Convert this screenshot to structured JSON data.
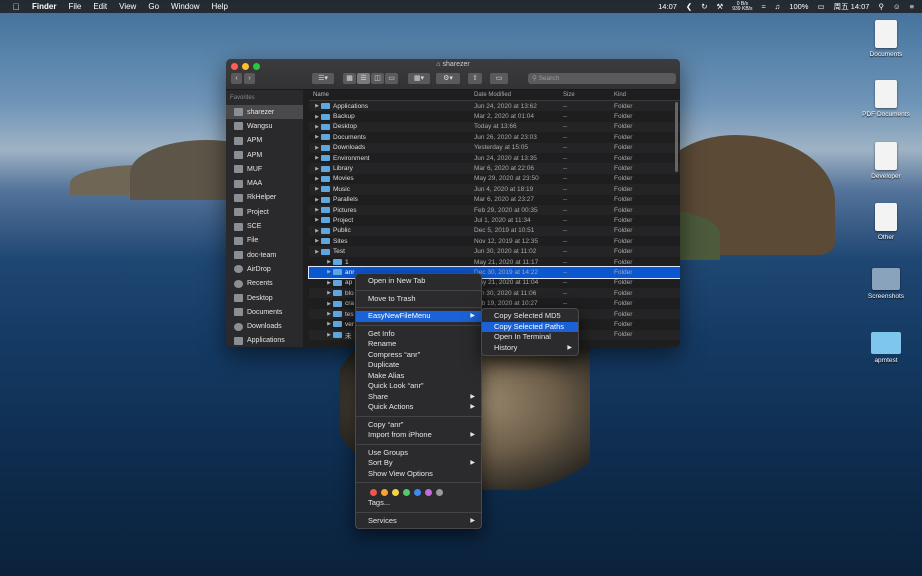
{
  "menubar": {
    "apple": "",
    "app": "Finder",
    "items": [
      "File",
      "Edit",
      "View",
      "Go",
      "Window",
      "Help"
    ],
    "time_left": "14:07",
    "net_up": "0 B/s",
    "net_down": "939 KB/s",
    "battery": "100%",
    "clock": "周五 14:07"
  },
  "desktop_icons": [
    {
      "label": "Documents",
      "kind": "doc"
    },
    {
      "label": "PDF Documents",
      "kind": "doc"
    },
    {
      "label": "Developer",
      "kind": "doc"
    },
    {
      "label": "Other",
      "kind": "doc"
    },
    {
      "label": "Screenshots",
      "kind": "doc"
    },
    {
      "label": "apmtest",
      "kind": "folder"
    }
  ],
  "window": {
    "title": "sharezer",
    "search_placeholder": "Search",
    "nav_back": "‹",
    "nav_fwd": "›",
    "sidebar_heading": "Favorites",
    "sidebar": [
      "sharezer",
      "Wangsu",
      "APM",
      "APM",
      "MUF",
      "MAA",
      "RkHelper",
      "Project",
      "SCE",
      "File",
      "doc-team",
      "AirDrop",
      "Recents",
      "Desktop",
      "Documents",
      "Downloads",
      "Applications"
    ],
    "columns": {
      "name": "Name",
      "date": "Date Modified",
      "size": "Size",
      "kind": "Kind"
    },
    "rows": [
      {
        "name": "Applications",
        "date": "Jun 24, 2020 at 13:62",
        "size": "--",
        "kind": "Folder",
        "indent": 0
      },
      {
        "name": "Backup",
        "date": "Mar 2, 2020 at 01:04",
        "size": "--",
        "kind": "Folder",
        "indent": 0
      },
      {
        "name": "Desktop",
        "date": "Today at 13:66",
        "size": "--",
        "kind": "Folder",
        "indent": 0
      },
      {
        "name": "Documents",
        "date": "Jun 26, 2020 at 23:03",
        "size": "--",
        "kind": "Folder",
        "indent": 0
      },
      {
        "name": "Downloads",
        "date": "Yesterday at 15:05",
        "size": "--",
        "kind": "Folder",
        "indent": 0
      },
      {
        "name": "Environment",
        "date": "Jun 24, 2020 at 13:35",
        "size": "--",
        "kind": "Folder",
        "indent": 0
      },
      {
        "name": "Library",
        "date": "Mar 6, 2020 at 22:06",
        "size": "--",
        "kind": "Folder",
        "indent": 0
      },
      {
        "name": "Movies",
        "date": "May 29, 2020 at 23:50",
        "size": "--",
        "kind": "Folder",
        "indent": 0
      },
      {
        "name": "Music",
        "date": "Jun 4, 2020 at 18:19",
        "size": "--",
        "kind": "Folder",
        "indent": 0
      },
      {
        "name": "Parallels",
        "date": "Mar 6, 2020 at 23:27",
        "size": "--",
        "kind": "Folder",
        "indent": 0
      },
      {
        "name": "Pictures",
        "date": "Feb 29, 2020 at 00:35",
        "size": "--",
        "kind": "Folder",
        "indent": 0
      },
      {
        "name": "Project",
        "date": "Jul 1, 2020 at 11:34",
        "size": "--",
        "kind": "Folder",
        "indent": 0
      },
      {
        "name": "Public",
        "date": "Dec 5, 2019 at 10:51",
        "size": "--",
        "kind": "Folder",
        "indent": 0
      },
      {
        "name": "Sites",
        "date": "Nov 12, 2019 at 12:35",
        "size": "--",
        "kind": "Folder",
        "indent": 0
      },
      {
        "name": "Test",
        "date": "Jun 30, 2020 at 11:02",
        "size": "--",
        "kind": "Folder",
        "indent": 0
      },
      {
        "name": "1",
        "date": "May 21, 2020 at 11:17",
        "size": "--",
        "kind": "Folder",
        "indent": 1
      },
      {
        "name": "anr",
        "date": "Dec 30, 2019 at 14:22",
        "size": "--",
        "kind": "Folder",
        "indent": 1,
        "selected": true
      },
      {
        "name": "ap",
        "date": "May 21, 2020 at 11:04",
        "size": "--",
        "kind": "Folder",
        "indent": 1
      },
      {
        "name": "blo",
        "date": "Jun 30, 2020 at 11:06",
        "size": "--",
        "kind": "Folder",
        "indent": 1
      },
      {
        "name": "cra",
        "date": "Feb 19, 2020 at 10:27",
        "size": "--",
        "kind": "Folder",
        "indent": 1
      },
      {
        "name": "tes",
        "date": "Jan 8, 2020 at 17:06",
        "size": "--",
        "kind": "Folder",
        "indent": 1
      },
      {
        "name": "ver",
        "date": "Jun 30, 2020 at 11:02",
        "size": "--",
        "kind": "Folder",
        "indent": 1
      },
      {
        "name": "未",
        "date": "Jun 3, 2020 at 14:07",
        "size": "--",
        "kind": "Folder",
        "indent": 1
      }
    ]
  },
  "context_menu": {
    "groups": [
      [
        "Open in New Tab"
      ],
      [
        "Move to Trash"
      ],
      [
        "EasyNewFileMenu"
      ],
      [
        "Get Info",
        "Rename",
        "Compress “anr”",
        "Duplicate",
        "Make Alias",
        "Quick Look “anr”",
        "Share",
        "Quick Actions"
      ],
      [
        "Copy “anr”",
        "Import from iPhone"
      ],
      [
        "Use Groups",
        "Sort By",
        "Show View Options"
      ]
    ],
    "tags_label": "Tags...",
    "services": "Services",
    "tag_colors": [
      "#f3554c",
      "#f7a23a",
      "#f5d33f",
      "#55c86a",
      "#3b8cf0",
      "#bf6fd8",
      "#9a9a9e"
    ]
  },
  "submenu": {
    "items": [
      "Copy Selected MD5",
      "Copy Selected Paths",
      "Open In Terminal",
      "History"
    ],
    "highlighted": "Copy Selected Paths"
  },
  "colors": {
    "accent": "#1a62d6",
    "folder": "#5fa8df"
  }
}
